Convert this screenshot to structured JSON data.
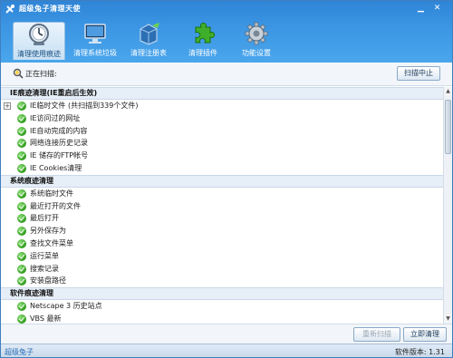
{
  "window": {
    "title": "超级兔子清理天使"
  },
  "tabs": [
    {
      "label": "清理使用痕迹",
      "icon": "clock-icon",
      "active": true
    },
    {
      "label": "清理系统垃圾",
      "icon": "monitor-icon",
      "active": false
    },
    {
      "label": "清理注册表",
      "icon": "registry-icon",
      "active": false
    },
    {
      "label": "清理插件",
      "icon": "puzzle-icon",
      "active": false
    },
    {
      "label": "功能设置",
      "icon": "gear-icon",
      "active": false
    }
  ],
  "scan": {
    "status": "正在扫描:",
    "stop_label": "扫描中止"
  },
  "groups": [
    {
      "title": "IE痕迹清理(IE重启后生效)",
      "items": [
        "IE临时文件 (共扫描到339个文件)",
        "IE访问过的网址",
        "IE自动完成的内容",
        "网络连接历史记录",
        "IE 储存的FTP帐号",
        "IE Cookies清理"
      ]
    },
    {
      "title": "系统痕迹清理",
      "items": [
        "系统临时文件",
        "最近打开的文件",
        "最后打开",
        "另外保存为",
        "查找文件菜单",
        "运行菜单",
        "搜索记录",
        "安装盘路径"
      ]
    },
    {
      "title": "软件痕迹清理",
      "items": [
        "Netscape 3 历史站点",
        "VBS 最新"
      ]
    }
  ],
  "actions": {
    "rescan_label": "重新扫描",
    "clean_label": "立即清理"
  },
  "footer": {
    "brand": "超级兔子",
    "version": "软件版本: 1.31"
  },
  "colors": {
    "titlebar": "#3b95e3",
    "accent": "#2a6fb8",
    "check": "#2d9a19"
  }
}
